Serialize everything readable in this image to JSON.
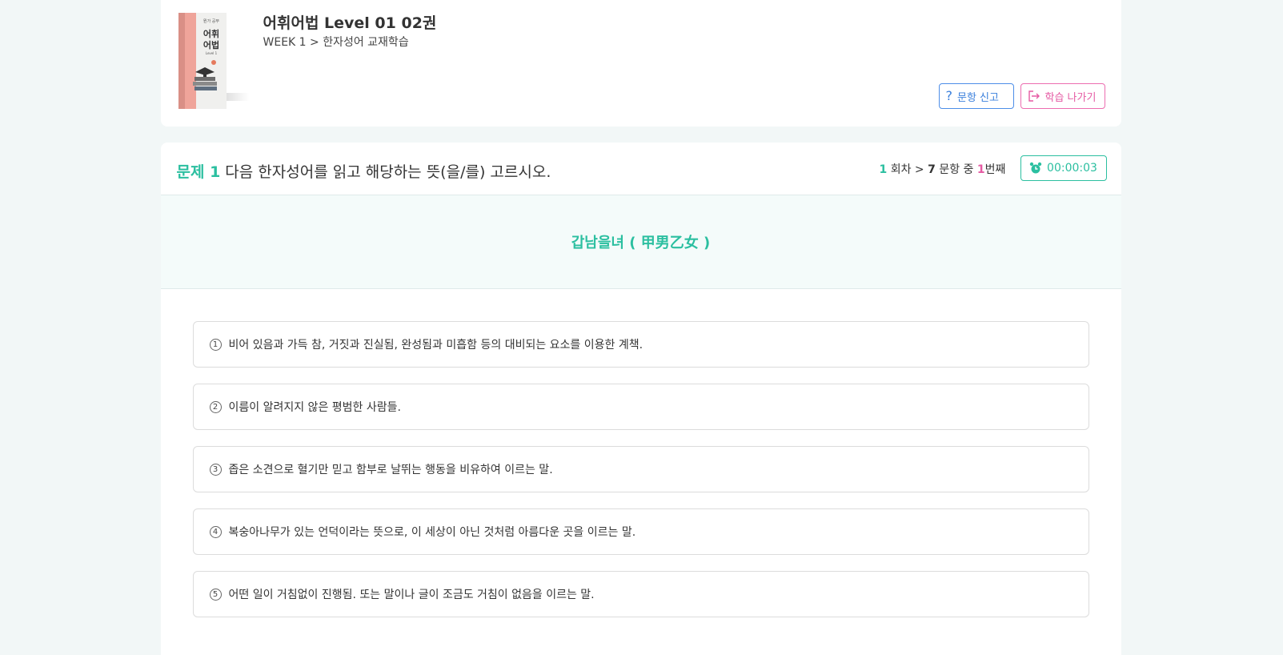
{
  "header": {
    "title": "어휘어법 Level 01 02권",
    "breadcrumb": "WEEK 1 > 한자성어 교재학습",
    "report_button": "문항 신고",
    "exit_button": "학습 나가기"
  },
  "book_cover": {
    "top_text": "뭔가 공부",
    "big_text_1": "어휘",
    "big_text_2": "어법",
    "level_text": "Level 1"
  },
  "question": {
    "label": "문제 1",
    "text": "다음 한자성어를 읽고 해당하는 뜻(을/를) 고르시오.",
    "round": "1",
    "round_suffix": "회차 >",
    "total": "7",
    "total_suffix": "문항 중",
    "current": "1",
    "current_suffix": "번째",
    "timer": "00:00:03",
    "idiom": "갑남을녀 ( 甲男乙女 )"
  },
  "options": [
    {
      "num": "1",
      "text": "비어 있음과 가득 참, 거짓과 진실됨, 완성됨과 미흡함 등의 대비되는 요소를 이용한 계책."
    },
    {
      "num": "2",
      "text": "이름이 알려지지 않은 평범한 사람들."
    },
    {
      "num": "3",
      "text": "좁은 소견으로 혈기만 믿고 함부로 날뛰는 행동을 비유하여 이르는 말."
    },
    {
      "num": "4",
      "text": "복숭아나무가 있는 언덕이라는 뜻으로, 이 세상이 아닌 것처럼 아름다운 곳을 이르는 말."
    },
    {
      "num": "5",
      "text": "어떤 일이 거침없이 진행됨. 또는 말이나 글이 조금도 거침이 없음을 이르는 말."
    }
  ],
  "colors": {
    "accent_green": "#2bbfa0",
    "accent_pink": "#e55aa3",
    "accent_blue": "#3a7fdc"
  },
  "icons": {
    "report": "question-mark-icon",
    "exit": "exit-icon",
    "timer": "alarm-clock-icon"
  }
}
